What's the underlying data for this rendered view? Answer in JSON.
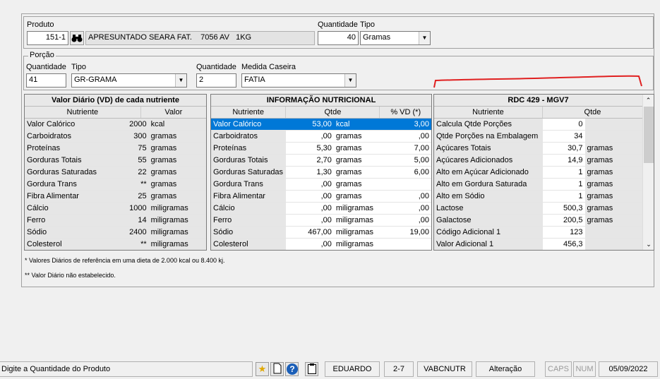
{
  "produto": {
    "label": "Produto",
    "code": "151-1",
    "description": "APRESUNTADO SEARA FAT.    7056 AV   1KG",
    "qtd_label": "Quantidade",
    "qtd": "40",
    "tipo_label": "Tipo",
    "tipo": "Gramas"
  },
  "porcao": {
    "title": "Porção",
    "qtd_label": "Quantidade",
    "qtd": "41",
    "tipo_label": "Tipo",
    "tipo": "GR-GRAMA",
    "qtd2_label": "Quantidade",
    "qtd2": "2",
    "medida_label": "Medida Caseira",
    "medida": "FATIA"
  },
  "vd": {
    "title": "Valor Diário (VD) de cada nutriente",
    "col_nutriente": "Nutriente",
    "col_valor": "Valor",
    "rows": [
      [
        "Valor Calórico",
        "2000",
        "kcal"
      ],
      [
        "Carboidratos",
        "300",
        "gramas"
      ],
      [
        "Proteínas",
        "75",
        "gramas"
      ],
      [
        "Gorduras Totais",
        "55",
        "gramas"
      ],
      [
        "Gorduras Saturadas",
        "22",
        "gramas"
      ],
      [
        "Gordura Trans",
        "**",
        "gramas"
      ],
      [
        "Fibra Alimentar",
        "25",
        "gramas"
      ],
      [
        "Cálcio",
        "1000",
        "miligramas"
      ],
      [
        "Ferro",
        "14",
        "miligramas"
      ],
      [
        "Sódio",
        "2400",
        "miligramas"
      ],
      [
        "Colesterol",
        "**",
        "miligramas"
      ]
    ]
  },
  "info": {
    "title": "INFORMAÇÃO NUTRICIONAL",
    "col_nutriente": "Nutriente",
    "col_qtde": "Qtde",
    "col_vd": "% VD (*)",
    "rows": [
      [
        "Valor Calórico",
        "53,00",
        "kcal",
        "3,00"
      ],
      [
        "Carboidratos",
        ",00",
        "gramas",
        ",00"
      ],
      [
        "Proteínas",
        "5,30",
        "gramas",
        "7,00"
      ],
      [
        "Gorduras Totais",
        "2,70",
        "gramas",
        "5,00"
      ],
      [
        "Gorduras Saturadas",
        "1,30",
        "gramas",
        "6,00"
      ],
      [
        "Gordura Trans",
        ",00",
        "gramas",
        ""
      ],
      [
        "Fibra Alimentar",
        ",00",
        "gramas",
        ",00"
      ],
      [
        "Cálcio",
        ",00",
        "miligramas",
        ",00"
      ],
      [
        "Ferro",
        ",00",
        "miligramas",
        ",00"
      ],
      [
        "Sódio",
        "467,00",
        "miligramas",
        "19,00"
      ],
      [
        "Colesterol",
        ",00",
        "miligramas",
        ""
      ]
    ]
  },
  "rdc": {
    "title": "RDC 429 - MGV7",
    "col_nutriente": "Nutriente",
    "col_qtde": "Qtde",
    "rows": [
      [
        "Calcula Qtde Porções",
        "0",
        ""
      ],
      [
        "Qtde Porções na Embalagem",
        "34",
        ""
      ],
      [
        "Açúcares Totais",
        "30,7",
        "gramas"
      ],
      [
        "Açúcares Adicionados",
        "14,9",
        "gramas"
      ],
      [
        "Alto em Açúcar Adicionado",
        "1",
        "gramas"
      ],
      [
        "Alto em Gordura Saturada",
        "1",
        "gramas"
      ],
      [
        "Alto em Sódio",
        "1",
        "gramas"
      ],
      [
        "Lactose",
        "500,3",
        "gramas"
      ],
      [
        "Galactose",
        "200,5",
        "gramas"
      ],
      [
        "Código Adicional 1",
        "123",
        ""
      ],
      [
        "Valor Adicional 1",
        "456,3",
        ""
      ]
    ]
  },
  "notes": {
    "note1": "* Valores Diários de referência em uma dieta de 2.000 kcal ou 8.400 kj.",
    "note2": "** Valor Diário não estabelecido."
  },
  "statusbar": {
    "message": "Digite a Quantidade do Produto",
    "user": "EDUARDO",
    "code": "2-7",
    "program": "VABCNUTR",
    "mode": "Alteração",
    "caps": "CAPS",
    "num": "NUM",
    "date": "05/09/2022"
  },
  "colors": {
    "selection": "#0078d7",
    "annotation": "#e02020"
  }
}
